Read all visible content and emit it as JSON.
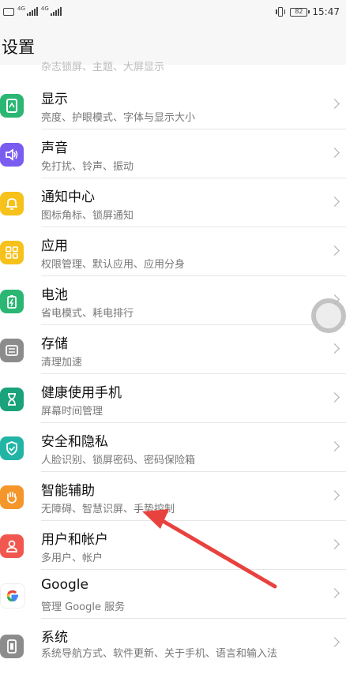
{
  "status_bar": {
    "network_left": "4G",
    "network_right": "4G",
    "battery": "82",
    "time": "15:47"
  },
  "header": {
    "title": "设置"
  },
  "peek_text": "杂志锁屏、主题、大屏显示",
  "items": [
    {
      "title": "显示",
      "subtitle": "亮度、护眼模式、字体与显示大小",
      "icon": "display-icon",
      "color": "#2bb673"
    },
    {
      "title": "声音",
      "subtitle": "免打扰、铃声、振动",
      "icon": "sound-icon",
      "color": "#7a5cf0"
    },
    {
      "title": "通知中心",
      "subtitle": "图标角标、锁屏通知",
      "icon": "notification-bell-icon",
      "color": "#f6c11b"
    },
    {
      "title": "应用",
      "subtitle": "权限管理、默认应用、应用分身",
      "icon": "apps-grid-icon",
      "color": "#f6c11b"
    },
    {
      "title": "电池",
      "subtitle": "省电模式、耗电排行",
      "icon": "battery-icon",
      "color": "#2bb673"
    },
    {
      "title": "存储",
      "subtitle": "清理加速",
      "icon": "storage-icon",
      "color": "#8c8c8c"
    },
    {
      "title": "健康使用手机",
      "subtitle": "屏幕时间管理",
      "icon": "hourglass-icon",
      "color": "#1aa27a"
    },
    {
      "title": "安全和隐私",
      "subtitle": "人脸识别、锁屏密码、密码保险箱",
      "icon": "shield-icon",
      "color": "#22b5a6"
    },
    {
      "title": "智能辅助",
      "subtitle": "无障碍、智慧识屏、手势控制",
      "icon": "hand-icon",
      "color": "#f5962b"
    },
    {
      "title": "用户和帐户",
      "subtitle": "多用户、帐户",
      "icon": "user-icon",
      "color": "#f0574f"
    },
    {
      "title": "Google",
      "subtitle": "管理 Google 服务",
      "icon": "google-icon",
      "color": "#ffffff"
    },
    {
      "title": "系统",
      "subtitle": "系统导航方式、软件更新、关于手机、语言和输入法",
      "icon": "system-icon",
      "color": "#8c8c8c"
    }
  ],
  "colors": {
    "arrow": "#e8423f",
    "background": "#ffffff"
  }
}
